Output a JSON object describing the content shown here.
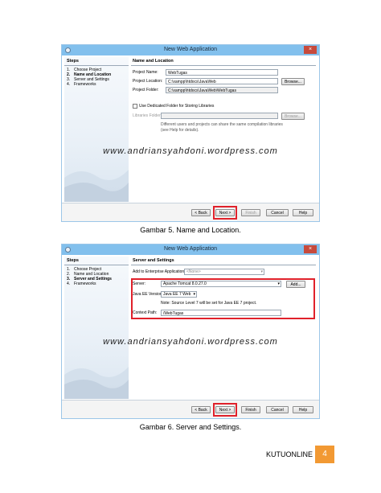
{
  "figure1": {
    "window_title": "New Web Application",
    "close_label": "×",
    "steps_title": "Steps",
    "steps": [
      {
        "num": "1.",
        "label": "Choose Project"
      },
      {
        "num": "2.",
        "label": "Name and Location"
      },
      {
        "num": "3.",
        "label": "Server and Settings"
      },
      {
        "num": "4.",
        "label": "Frameworks"
      }
    ],
    "panel_title": "Name and Location",
    "project_name_label": "Project Name:",
    "project_name_value": "WebTugas",
    "project_location_label": "Project Location:",
    "project_location_value": "C:\\xampp\\htdocs\\JavaWeb",
    "browse_label": "Browse...",
    "project_folder_label": "Project Folder:",
    "project_folder_value": "C:\\xampp\\htdocs\\JavaWeb\\WebTugas",
    "dedicated_folder_label": "Use Dedicated Folder for Storing Libraries",
    "libraries_folder_label": "Libraries Folder:",
    "libraries_folder_value": "",
    "browse2_label": "Browse...",
    "help_text_line1": "Different users and projects can share the same compilation libraries",
    "help_text_line2": "(see Help for details).",
    "buttons": {
      "back": "< Back",
      "next": "Next >",
      "finish": "Finish",
      "cancel": "Cancel",
      "help": "Help"
    }
  },
  "figure2": {
    "window_title": "New Web Application",
    "close_label": "×",
    "steps_title": "Steps",
    "steps": [
      {
        "num": "1.",
        "label": "Choose Project"
      },
      {
        "num": "2.",
        "label": "Name and Location"
      },
      {
        "num": "3.",
        "label": "Server and Settings"
      },
      {
        "num": "4.",
        "label": "Frameworks"
      }
    ],
    "panel_title": "Server and Settings",
    "enterprise_label": "Add to Enterprise Application:",
    "enterprise_value": "<None>",
    "server_label": "Server:",
    "server_value": "Apache Tomcat 8.0.27.0",
    "add_label": "Add...",
    "javaee_label": "Java EE Version:",
    "javaee_value": "Java EE 7 Web",
    "note_text": "Note: Source Level 7 will be set for Java EE 7 project.",
    "context_label": "Context Path:",
    "context_value": "/WebTugas",
    "buttons": {
      "back": "< Back",
      "next": "Next >",
      "finish": "Finish",
      "cancel": "Cancel",
      "help": "Help"
    }
  },
  "watermark": "www.andriansyahdoni.wordpress.com",
  "caption1": "Gambar 5. Name and Location.",
  "caption2": "Gambar 6. Server and Settings.",
  "footer": {
    "brand": "KUTUONLINE",
    "page_number": "4"
  },
  "colors": {
    "titlebar": "#82c0ed",
    "highlight": "#e0212b",
    "page_badge": "#f29933",
    "close": "#c74a3c"
  }
}
